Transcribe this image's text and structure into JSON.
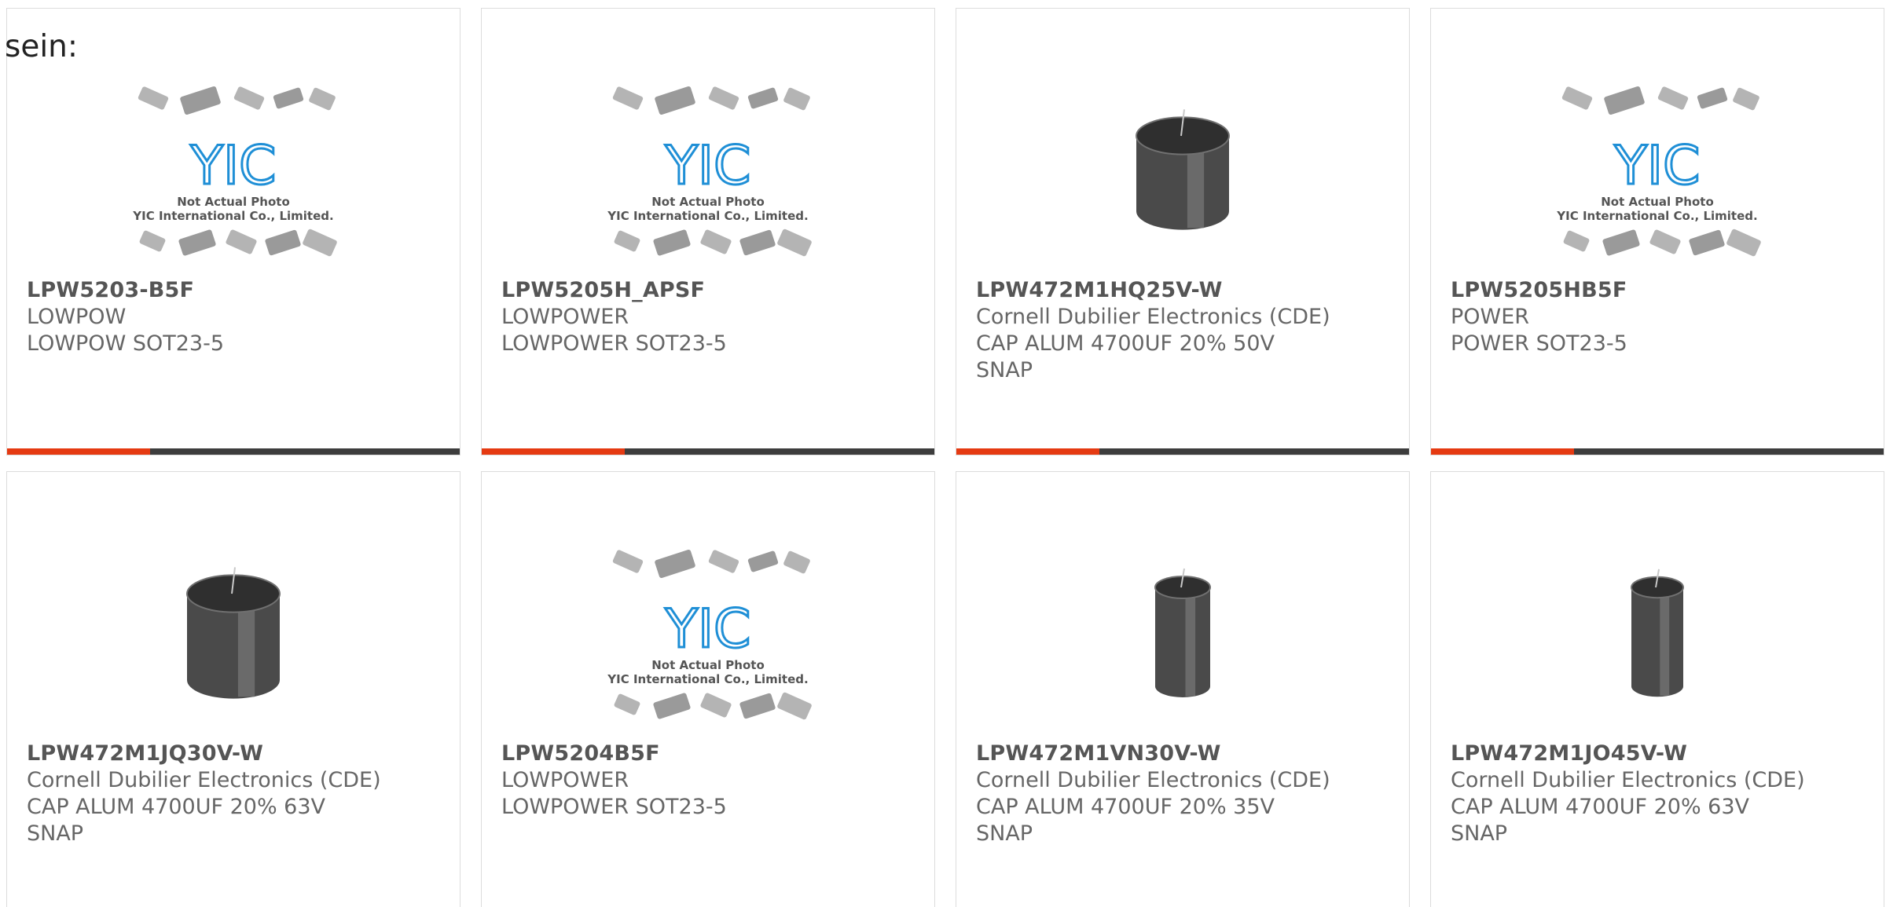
{
  "intro_text": "sein:",
  "placeholder": {
    "logo": "YIC",
    "line1": "Not Actual Photo",
    "line2": "YIC International Co., Limited."
  },
  "colors": {
    "accent": "#e53a12",
    "bar": "#3d3d3d",
    "border": "#dcdcdc",
    "logo_blue": "#1f8fd6"
  },
  "products": [
    {
      "part_number": "LPW5203-B5F",
      "manufacturer": "LOWPOW",
      "description": "LOWPOW SOT23-5",
      "image": "yic-placeholder"
    },
    {
      "part_number": "LPW5205H_APSF",
      "manufacturer": "LOWPOWER",
      "description": "LOWPOWER SOT23-5",
      "image": "yic-placeholder"
    },
    {
      "part_number": "LPW472M1HQ25V-W",
      "manufacturer": "Cornell Dubilier Electronics (CDE)",
      "description": "CAP ALUM 4700UF 20% 50V SNAP",
      "image": "capacitor-squat"
    },
    {
      "part_number": "LPW5205HB5F",
      "manufacturer": "POWER",
      "description": "POWER SOT23-5",
      "image": "yic-placeholder"
    },
    {
      "part_number": "LPW472M1JQ30V-W",
      "manufacturer": "Cornell Dubilier Electronics (CDE)",
      "description": "CAP ALUM 4700UF 20% 63V SNAP",
      "image": "capacitor-wide"
    },
    {
      "part_number": "LPW5204B5F",
      "manufacturer": "LOWPOWER",
      "description": "LOWPOWER SOT23-5",
      "image": "yic-placeholder"
    },
    {
      "part_number": "LPW472M1VN30V-W",
      "manufacturer": "Cornell Dubilier Electronics (CDE)",
      "description": "CAP ALUM 4700UF 20% 35V SNAP",
      "image": "capacitor-tall"
    },
    {
      "part_number": "LPW472M1JO45V-W",
      "manufacturer": "Cornell Dubilier Electronics (CDE)",
      "description": "CAP ALUM 4700UF 20% 63V SNAP",
      "image": "capacitor-slim"
    }
  ]
}
